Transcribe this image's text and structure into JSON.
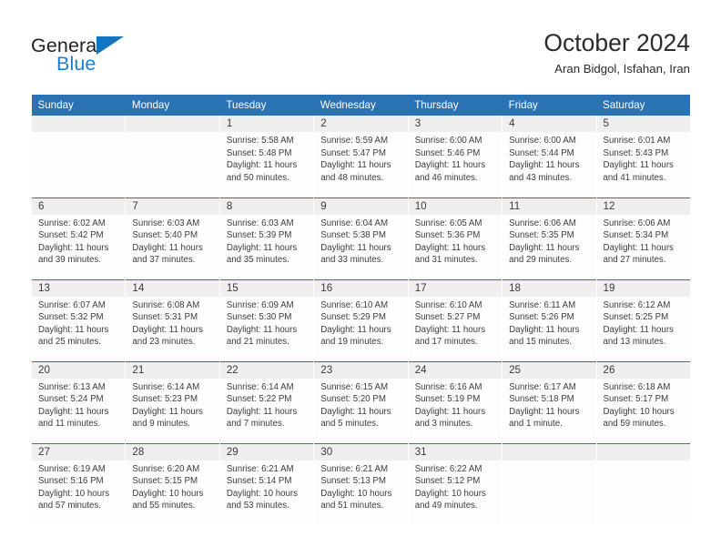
{
  "brand": {
    "logo_text_top": "General",
    "logo_text_bottom": "Blue",
    "logo_icon": "triangle-icon",
    "accent_color": "#1b7fd1",
    "header_color": "#2b72b5"
  },
  "header": {
    "title": "October 2024",
    "subtitle": "Aran Bidgol, Isfahan, Iran"
  },
  "calendar": {
    "weekday_headers": [
      "Sunday",
      "Monday",
      "Tuesday",
      "Wednesday",
      "Thursday",
      "Friday",
      "Saturday"
    ],
    "weeks": [
      [
        {
          "day": "",
          "empty": true,
          "lines": []
        },
        {
          "day": "",
          "empty": true,
          "lines": []
        },
        {
          "day": "1",
          "lines": [
            "Sunrise: 5:58 AM",
            "Sunset: 5:48 PM",
            "Daylight: 11 hours",
            "and 50 minutes."
          ]
        },
        {
          "day": "2",
          "lines": [
            "Sunrise: 5:59 AM",
            "Sunset: 5:47 PM",
            "Daylight: 11 hours",
            "and 48 minutes."
          ]
        },
        {
          "day": "3",
          "lines": [
            "Sunrise: 6:00 AM",
            "Sunset: 5:46 PM",
            "Daylight: 11 hours",
            "and 46 minutes."
          ]
        },
        {
          "day": "4",
          "lines": [
            "Sunrise: 6:00 AM",
            "Sunset: 5:44 PM",
            "Daylight: 11 hours",
            "and 43 minutes."
          ]
        },
        {
          "day": "5",
          "lines": [
            "Sunrise: 6:01 AM",
            "Sunset: 5:43 PM",
            "Daylight: 11 hours",
            "and 41 minutes."
          ]
        }
      ],
      [
        {
          "day": "6",
          "lines": [
            "Sunrise: 6:02 AM",
            "Sunset: 5:42 PM",
            "Daylight: 11 hours",
            "and 39 minutes."
          ]
        },
        {
          "day": "7",
          "lines": [
            "Sunrise: 6:03 AM",
            "Sunset: 5:40 PM",
            "Daylight: 11 hours",
            "and 37 minutes."
          ]
        },
        {
          "day": "8",
          "lines": [
            "Sunrise: 6:03 AM",
            "Sunset: 5:39 PM",
            "Daylight: 11 hours",
            "and 35 minutes."
          ]
        },
        {
          "day": "9",
          "lines": [
            "Sunrise: 6:04 AM",
            "Sunset: 5:38 PM",
            "Daylight: 11 hours",
            "and 33 minutes."
          ]
        },
        {
          "day": "10",
          "lines": [
            "Sunrise: 6:05 AM",
            "Sunset: 5:36 PM",
            "Daylight: 11 hours",
            "and 31 minutes."
          ]
        },
        {
          "day": "11",
          "lines": [
            "Sunrise: 6:06 AM",
            "Sunset: 5:35 PM",
            "Daylight: 11 hours",
            "and 29 minutes."
          ]
        },
        {
          "day": "12",
          "lines": [
            "Sunrise: 6:06 AM",
            "Sunset: 5:34 PM",
            "Daylight: 11 hours",
            "and 27 minutes."
          ]
        }
      ],
      [
        {
          "day": "13",
          "lines": [
            "Sunrise: 6:07 AM",
            "Sunset: 5:32 PM",
            "Daylight: 11 hours",
            "and 25 minutes."
          ]
        },
        {
          "day": "14",
          "lines": [
            "Sunrise: 6:08 AM",
            "Sunset: 5:31 PM",
            "Daylight: 11 hours",
            "and 23 minutes."
          ]
        },
        {
          "day": "15",
          "lines": [
            "Sunrise: 6:09 AM",
            "Sunset: 5:30 PM",
            "Daylight: 11 hours",
            "and 21 minutes."
          ]
        },
        {
          "day": "16",
          "lines": [
            "Sunrise: 6:10 AM",
            "Sunset: 5:29 PM",
            "Daylight: 11 hours",
            "and 19 minutes."
          ]
        },
        {
          "day": "17",
          "lines": [
            "Sunrise: 6:10 AM",
            "Sunset: 5:27 PM",
            "Daylight: 11 hours",
            "and 17 minutes."
          ]
        },
        {
          "day": "18",
          "lines": [
            "Sunrise: 6:11 AM",
            "Sunset: 5:26 PM",
            "Daylight: 11 hours",
            "and 15 minutes."
          ]
        },
        {
          "day": "19",
          "lines": [
            "Sunrise: 6:12 AM",
            "Sunset: 5:25 PM",
            "Daylight: 11 hours",
            "and 13 minutes."
          ]
        }
      ],
      [
        {
          "day": "20",
          "lines": [
            "Sunrise: 6:13 AM",
            "Sunset: 5:24 PM",
            "Daylight: 11 hours",
            "and 11 minutes."
          ]
        },
        {
          "day": "21",
          "lines": [
            "Sunrise: 6:14 AM",
            "Sunset: 5:23 PM",
            "Daylight: 11 hours",
            "and 9 minutes."
          ]
        },
        {
          "day": "22",
          "lines": [
            "Sunrise: 6:14 AM",
            "Sunset: 5:22 PM",
            "Daylight: 11 hours",
            "and 7 minutes."
          ]
        },
        {
          "day": "23",
          "lines": [
            "Sunrise: 6:15 AM",
            "Sunset: 5:20 PM",
            "Daylight: 11 hours",
            "and 5 minutes."
          ]
        },
        {
          "day": "24",
          "lines": [
            "Sunrise: 6:16 AM",
            "Sunset: 5:19 PM",
            "Daylight: 11 hours",
            "and 3 minutes."
          ]
        },
        {
          "day": "25",
          "lines": [
            "Sunrise: 6:17 AM",
            "Sunset: 5:18 PM",
            "Daylight: 11 hours",
            "and 1 minute."
          ]
        },
        {
          "day": "26",
          "lines": [
            "Sunrise: 6:18 AM",
            "Sunset: 5:17 PM",
            "Daylight: 10 hours",
            "and 59 minutes."
          ]
        }
      ],
      [
        {
          "day": "27",
          "lines": [
            "Sunrise: 6:19 AM",
            "Sunset: 5:16 PM",
            "Daylight: 10 hours",
            "and 57 minutes."
          ]
        },
        {
          "day": "28",
          "lines": [
            "Sunrise: 6:20 AM",
            "Sunset: 5:15 PM",
            "Daylight: 10 hours",
            "and 55 minutes."
          ]
        },
        {
          "day": "29",
          "lines": [
            "Sunrise: 6:21 AM",
            "Sunset: 5:14 PM",
            "Daylight: 10 hours",
            "and 53 minutes."
          ]
        },
        {
          "day": "30",
          "lines": [
            "Sunrise: 6:21 AM",
            "Sunset: 5:13 PM",
            "Daylight: 10 hours",
            "and 51 minutes."
          ]
        },
        {
          "day": "31",
          "lines": [
            "Sunrise: 6:22 AM",
            "Sunset: 5:12 PM",
            "Daylight: 10 hours",
            "and 49 minutes."
          ]
        },
        {
          "day": "",
          "empty": true,
          "lines": []
        },
        {
          "day": "",
          "empty": true,
          "lines": []
        }
      ]
    ]
  }
}
